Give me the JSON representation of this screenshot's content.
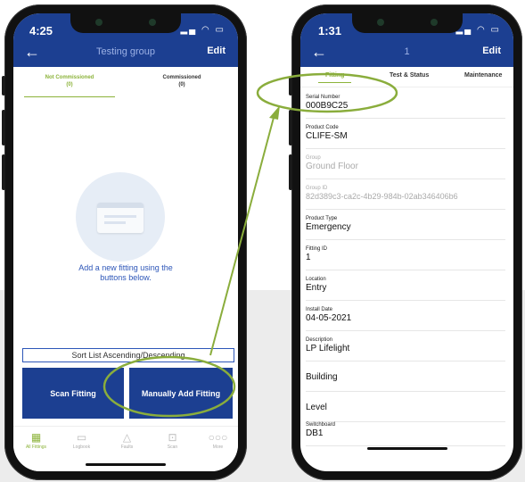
{
  "left_phone": {
    "status_time": "4:25",
    "nav": {
      "title": "Testing group",
      "edit_label": "Edit"
    },
    "tabs": [
      {
        "label": "Not Commissioned",
        "count": "(0)",
        "active": true
      },
      {
        "label": "Commissioned",
        "count": "(0)",
        "active": false
      }
    ],
    "empty_message_line1": "Add a new fitting using the",
    "empty_message_line2": "buttons below.",
    "sort_label": "Sort List Ascending/Descending",
    "scan_button_label": "Scan Fitting",
    "manual_button_label": "Manually Add Fitting",
    "tabbar": [
      {
        "label": "All Fittings",
        "icon": "grid-icon",
        "active": true
      },
      {
        "label": "Logbook",
        "icon": "calendar-icon",
        "active": false
      },
      {
        "label": "Faults",
        "icon": "warning-icon",
        "active": false
      },
      {
        "label": "Scan",
        "icon": "scan-icon",
        "active": false
      },
      {
        "label": "More",
        "icon": "more-icon",
        "active": false
      }
    ]
  },
  "right_phone": {
    "status_time": "1:31",
    "nav": {
      "title": "1",
      "edit_label": "Edit"
    },
    "tabs": [
      {
        "label": "Fitting",
        "active": true
      },
      {
        "label": "Test & Status",
        "active": false
      },
      {
        "label": "Maintenance",
        "active": false
      }
    ],
    "fields": [
      {
        "label": "Serial Number",
        "value": "000B9C25",
        "disabled": false
      },
      {
        "label": "Product Code",
        "value": "CLIFE-SM",
        "disabled": false
      },
      {
        "label": "Group",
        "value": "Ground Floor",
        "disabled": true
      },
      {
        "label": "Group ID",
        "value": "82d389c3-ca2c-4b29-984b-02ab346406b6",
        "disabled": true
      },
      {
        "label": "Product Type",
        "value": "Emergency",
        "disabled": false
      },
      {
        "label": "Fitting ID",
        "value": "1",
        "disabled": false
      },
      {
        "label": "Location",
        "value": "Entry",
        "disabled": false
      },
      {
        "label": "Install Date",
        "value": "04-05-2021",
        "disabled": false
      },
      {
        "label": "Description",
        "value": "LP Lifelight",
        "disabled": false
      },
      {
        "label": "",
        "value": "Building",
        "disabled": false
      },
      {
        "label": "",
        "value": "Level",
        "disabled": false
      },
      {
        "label": "Switchboard",
        "value": "DB1",
        "disabled": false
      }
    ]
  },
  "colors": {
    "nav_blue": "#1c3f91",
    "accent_green": "#8cb33a",
    "link_blue": "#2d56b8",
    "highlight_green": "#8aad3c"
  }
}
